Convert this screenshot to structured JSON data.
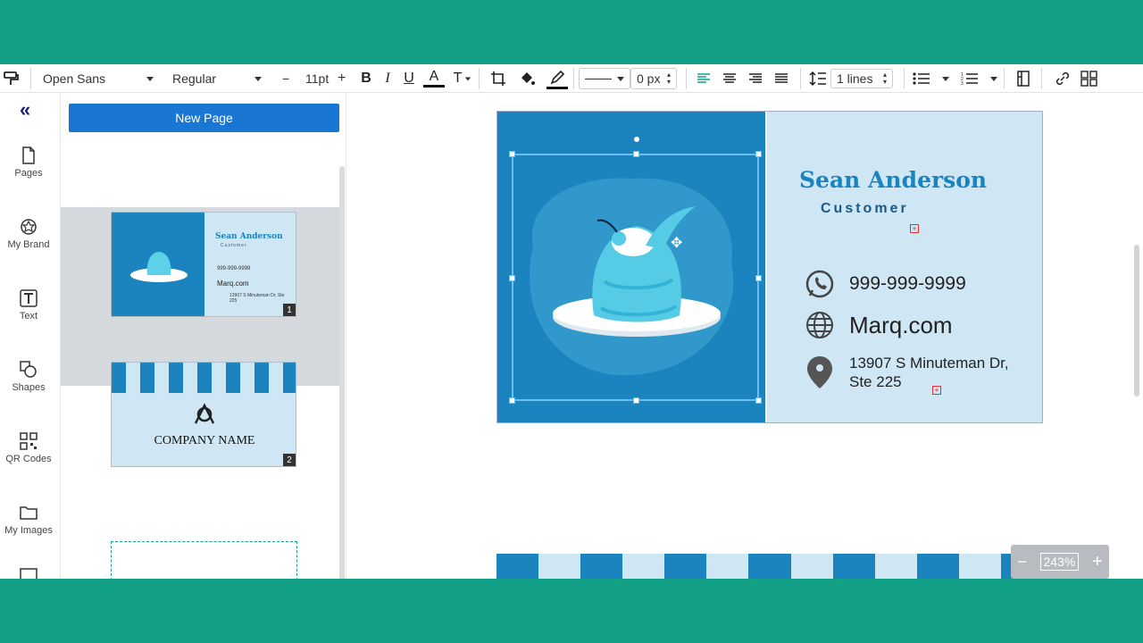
{
  "toolbar": {
    "font_family": "Open Sans",
    "font_style": "Regular",
    "font_size": "11pt",
    "minus": "−",
    "plus": "+",
    "bold": "B",
    "italic": "I",
    "underline": "U",
    "font_color": "A",
    "text_transform": "T",
    "stroke_width": "0 px",
    "line_spacing": "1 lines"
  },
  "rail": {
    "items": [
      {
        "label": "Pages",
        "icon": "page-icon"
      },
      {
        "label": "My Brand",
        "icon": "brand-icon"
      },
      {
        "label": "Text",
        "icon": "text-icon"
      },
      {
        "label": "Shapes",
        "icon": "shapes-icon"
      },
      {
        "label": "QR Codes",
        "icon": "qr-code-icon"
      },
      {
        "label": "My Images",
        "icon": "folder-icon"
      }
    ]
  },
  "panel": {
    "new_page_label": "New Page",
    "pages": [
      {
        "number": "1",
        "name": "Sean Anderson",
        "role": "Customer",
        "phone": "999-999-9999",
        "web": "Marq.com",
        "address": "13907 S Minuteman Dr, Ste 225"
      },
      {
        "number": "2",
        "company": "COMPANY NAME"
      }
    ]
  },
  "card": {
    "name": "Sean Anderson",
    "role": "Customer",
    "phone": "999-999-9999",
    "website": "Marq.com",
    "address_line1": "13907 S Minuteman Dr,",
    "address_line2": "Ste 225"
  },
  "zoom": {
    "minus": "−",
    "value": "243%",
    "plus": "+"
  },
  "colors": {
    "brand_band": "#12a187",
    "card_dark": "#1b84be",
    "card_light": "#cfe7f5",
    "button_blue": "#1976d2"
  }
}
